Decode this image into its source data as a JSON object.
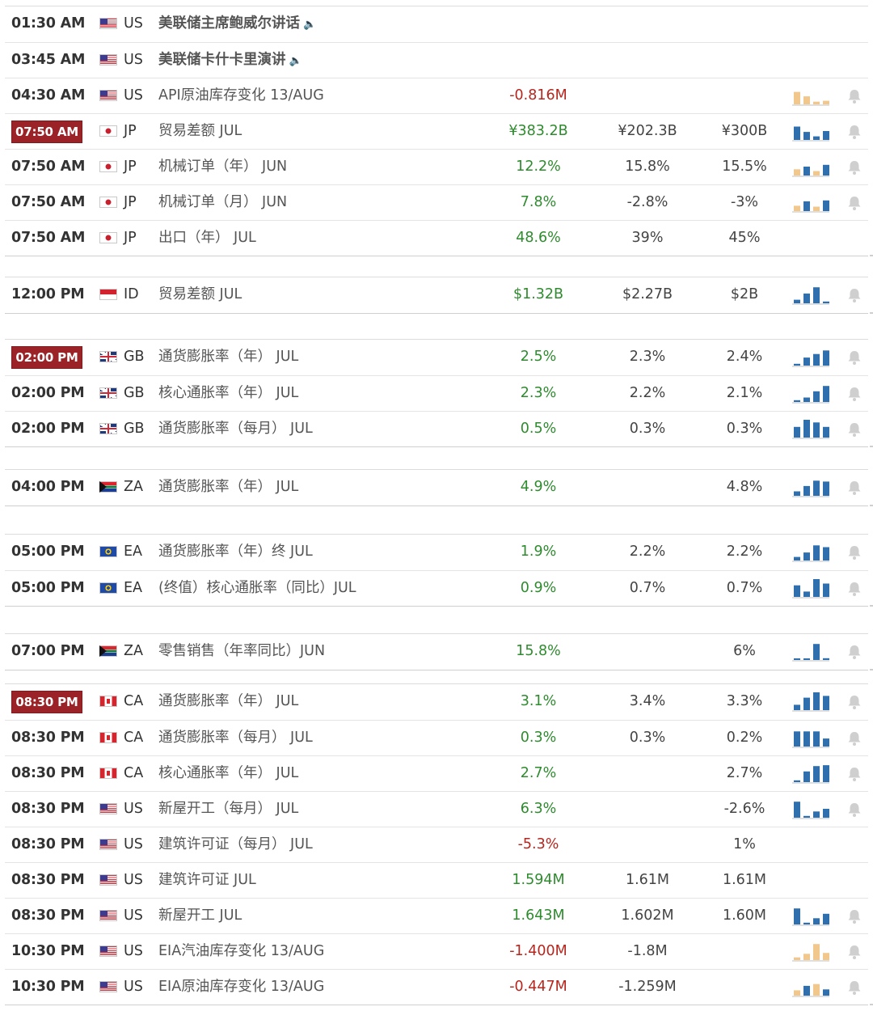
{
  "colors": {
    "highlight": "#9b2226",
    "positive": "#2e8b2e",
    "negative": "#b5261e",
    "chart_blue": "#2f6fae",
    "chart_tan": "#f2c78c",
    "bell": "#cfcfcf"
  },
  "groups": [
    {
      "rows": [
        {
          "time": "01:30 AM",
          "flag": "us",
          "cur": "US",
          "name": "美联储主席鲍威尔讲话",
          "bold": true,
          "speech": true,
          "actual": "",
          "tone": "",
          "forecast": "",
          "previous": "",
          "chart": null,
          "chart_color": "",
          "bell": false
        },
        {
          "time": "03:45 AM",
          "flag": "us",
          "cur": "US",
          "name": "美联储卡什卡里演讲",
          "bold": true,
          "speech": true,
          "actual": "",
          "tone": "",
          "forecast": "",
          "previous": "",
          "chart": null,
          "chart_color": "",
          "bell": false
        },
        {
          "time": "04:30 AM",
          "flag": "us",
          "cur": "US",
          "name": "API原油库存变化 13/AUG",
          "bold": false,
          "speech": false,
          "actual": "-0.816M",
          "tone": "neg",
          "forecast": "",
          "previous": "",
          "chart": [
            0.7,
            0.45,
            0.15,
            0.2
          ],
          "chart_color": "tan",
          "bell": true
        },
        {
          "time": "07:50 AM",
          "hl": true,
          "flag": "jp",
          "cur": "JP",
          "name": "贸易差额 JUL",
          "bold": false,
          "speech": false,
          "actual": "¥383.2B",
          "tone": "pos",
          "forecast": "¥202.3B",
          "previous": "¥300B",
          "chart": [
            0.75,
            0.45,
            0.2,
            0.5
          ],
          "chart_color": "blue",
          "bell": true
        },
        {
          "time": "07:50 AM",
          "flag": "jp",
          "cur": "JP",
          "name": "机械订单（年） JUN",
          "bold": false,
          "speech": false,
          "actual": "12.2%",
          "tone": "pos",
          "forecast": "15.8%",
          "previous": "15.5%",
          "chart": [
            0.35,
            0.5,
            0.25,
            0.6
          ],
          "chart_color": "mixed",
          "bell": true
        },
        {
          "time": "07:50 AM",
          "flag": "jp",
          "cur": "JP",
          "name": "机械订单（月） JUN",
          "bold": false,
          "speech": false,
          "actual": "7.8%",
          "tone": "pos",
          "forecast": "-2.8%",
          "previous": "-3%",
          "chart": [
            0.3,
            0.55,
            0.25,
            0.6
          ],
          "chart_color": "mixed",
          "bell": true
        },
        {
          "time": "07:50 AM",
          "flag": "jp",
          "cur": "JP",
          "name": "出口（年） JUL",
          "bold": false,
          "speech": false,
          "actual": "48.6%",
          "tone": "pos",
          "forecast": "39%",
          "previous": "45%",
          "chart": null,
          "chart_color": "",
          "bell": false
        }
      ]
    },
    {
      "rows": [
        {
          "time": "12:00 PM",
          "flag": "id",
          "cur": "ID",
          "name": "贸易差额 JUL",
          "bold": false,
          "speech": false,
          "actual": "$1.32B",
          "tone": "pos",
          "forecast": "$2.27B",
          "previous": "$2B",
          "chart": [
            0.2,
            0.55,
            0.9,
            0.1
          ],
          "chart_color": "blue",
          "bell": true
        }
      ]
    },
    {
      "rows": [
        {
          "time": "02:00 PM",
          "hl": true,
          "flag": "gb",
          "cur": "GB",
          "name": "通货膨胀率（年） JUL",
          "bold": false,
          "speech": false,
          "actual": "2.5%",
          "tone": "pos",
          "forecast": "2.3%",
          "previous": "2.4%",
          "chart": [
            0.1,
            0.45,
            0.65,
            0.85
          ],
          "chart_color": "blue",
          "bell": true
        },
        {
          "time": "02:00 PM",
          "flag": "gb",
          "cur": "GB",
          "name": "核心通胀率（年） JUL",
          "bold": false,
          "speech": false,
          "actual": "2.3%",
          "tone": "pos",
          "forecast": "2.2%",
          "previous": "2.1%",
          "chart": [
            0.1,
            0.25,
            0.6,
            0.9
          ],
          "chart_color": "blue",
          "bell": true
        },
        {
          "time": "02:00 PM",
          "flag": "gb",
          "cur": "GB",
          "name": "通货膨胀率（每月） JUL",
          "bold": false,
          "speech": false,
          "actual": "0.5%",
          "tone": "pos",
          "forecast": "0.3%",
          "previous": "0.3%",
          "chart": [
            0.6,
            1.0,
            0.85,
            0.6
          ],
          "chart_color": "blue",
          "bell": true
        }
      ]
    },
    {
      "rows": [
        {
          "time": "04:00 PM",
          "flag": "za",
          "cur": "ZA",
          "name": "通货膨胀率（年） JUL",
          "bold": false,
          "speech": false,
          "actual": "4.9%",
          "tone": "pos",
          "forecast": "",
          "previous": "4.8%",
          "chart": [
            0.25,
            0.55,
            0.85,
            0.8
          ],
          "chart_color": "blue",
          "bell": true
        }
      ]
    },
    {
      "rows": [
        {
          "time": "05:00 PM",
          "flag": "ea",
          "cur": "EA",
          "name": "通货膨胀率（年）终 JUL",
          "bold": false,
          "speech": false,
          "actual": "1.9%",
          "tone": "pos",
          "forecast": "2.2%",
          "previous": "2.2%",
          "chart": [
            0.2,
            0.45,
            0.85,
            0.75
          ],
          "chart_color": "blue",
          "bell": true
        },
        {
          "time": "05:00 PM",
          "flag": "ea",
          "cur": "EA",
          "name": "(终值）核心通胀率（同比）JUL",
          "bold": false,
          "speech": false,
          "actual": "0.9%",
          "tone": "pos",
          "forecast": "0.7%",
          "previous": "0.7%",
          "chart": [
            0.65,
            0.3,
            1.0,
            0.75
          ],
          "chart_color": "blue",
          "bell": true
        }
      ]
    },
    {
      "rows": [
        {
          "time": "07:00 PM",
          "flag": "za",
          "cur": "ZA",
          "name": "零售销售（年率同比）JUN",
          "bold": false,
          "speech": false,
          "actual": "15.8%",
          "tone": "pos",
          "forecast": "",
          "previous": "6%",
          "chart": [
            0.05,
            0.05,
            0.9,
            0.1
          ],
          "chart_color": "blue",
          "bell": true
        }
      ]
    },
    {
      "rows": [
        {
          "time": "08:30 PM",
          "hl": true,
          "flag": "ca",
          "cur": "CA",
          "name": "通货膨胀率（年） JUL",
          "bold": false,
          "speech": false,
          "actual": "3.1%",
          "tone": "pos",
          "forecast": "3.4%",
          "previous": "3.3%",
          "chart": [
            0.3,
            0.7,
            1.0,
            0.8
          ],
          "chart_color": "blue",
          "bell": true
        },
        {
          "time": "08:30 PM",
          "flag": "ca",
          "cur": "CA",
          "name": "通货膨胀率（每月） JUL",
          "bold": false,
          "speech": false,
          "actual": "0.3%",
          "tone": "pos",
          "forecast": "0.3%",
          "previous": "0.2%",
          "chart": [
            0.85,
            0.85,
            0.85,
            0.45
          ],
          "chart_color": "blue",
          "bell": true
        },
        {
          "time": "08:30 PM",
          "flag": "ca",
          "cur": "CA",
          "name": "核心通胀率（年） JUL",
          "bold": false,
          "speech": false,
          "actual": "2.7%",
          "tone": "pos",
          "forecast": "",
          "previous": "2.7%",
          "chart": [
            0.1,
            0.6,
            0.9,
            0.95
          ],
          "chart_color": "blue",
          "bell": true
        },
        {
          "time": "08:30 PM",
          "flag": "us",
          "cur": "US",
          "name": "新屋开工（每月） JUL",
          "bold": false,
          "speech": false,
          "actual": "6.3%",
          "tone": "pos",
          "forecast": "",
          "previous": "-2.6%",
          "chart": [
            0.9,
            0.1,
            0.35,
            0.5
          ],
          "chart_color": "blue",
          "bell": true
        },
        {
          "time": "08:30 PM",
          "flag": "us",
          "cur": "US",
          "name": "建筑许可证（每月） JUL",
          "bold": false,
          "speech": false,
          "actual": "-5.3%",
          "tone": "neg",
          "forecast": "",
          "previous": "1%",
          "chart": null,
          "chart_color": "",
          "bell": false
        },
        {
          "time": "08:30 PM",
          "flag": "us",
          "cur": "US",
          "name": "建筑许可证 JUL",
          "bold": false,
          "speech": false,
          "actual": "1.594M",
          "tone": "pos",
          "forecast": "1.61M",
          "previous": "1.61M",
          "chart": null,
          "chart_color": "",
          "bell": false
        },
        {
          "time": "08:30 PM",
          "flag": "us",
          "cur": "US",
          "name": "新屋开工 JUL",
          "bold": false,
          "speech": false,
          "actual": "1.643M",
          "tone": "pos",
          "forecast": "1.602M",
          "previous": "1.60M",
          "chart": [
            0.9,
            0.1,
            0.35,
            0.6
          ],
          "chart_color": "blue",
          "bell": true
        },
        {
          "time": "10:30 PM",
          "flag": "us",
          "cur": "US",
          "name": "EIA汽油库存变化 13/AUG",
          "bold": false,
          "speech": false,
          "actual": "-1.400M",
          "tone": "neg",
          "forecast": "-1.8M",
          "previous": "",
          "chart": [
            0.15,
            0.35,
            0.9,
            0.4
          ],
          "chart_color": "tan",
          "bell": true
        },
        {
          "time": "10:30 PM",
          "flag": "us",
          "cur": "US",
          "name": "EIA原油库存变化 13/AUG",
          "bold": false,
          "speech": false,
          "actual": "-0.447M",
          "tone": "neg",
          "forecast": "-1.259M",
          "previous": "",
          "chart": [
            0.3,
            0.55,
            0.65,
            0.35
          ],
          "chart_color": "mixed",
          "bell": true
        }
      ]
    }
  ]
}
